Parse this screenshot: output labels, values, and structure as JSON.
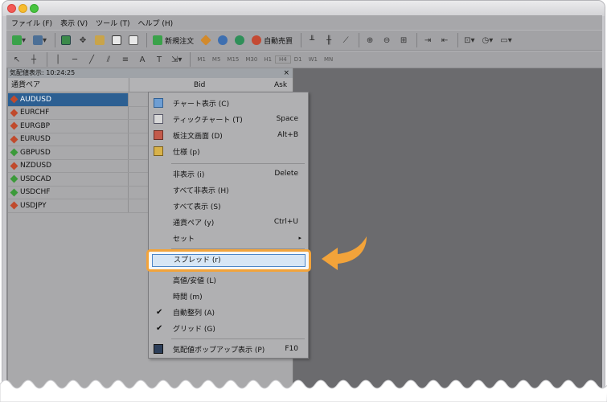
{
  "menubar": {
    "items": [
      "ファイル (F)",
      "表示 (V)",
      "ツール (T)",
      "ヘルプ (H)"
    ]
  },
  "toolbar": {
    "new_order": "新規注文",
    "auto_trade": "自動売買"
  },
  "timeframes": [
    "M1",
    "M5",
    "M15",
    "M30",
    "H1",
    "H4",
    "D1",
    "W1",
    "MN"
  ],
  "market_watch": {
    "title": "気配値表示: 10:24:25",
    "close": "×",
    "col_pair": "通貨ペア",
    "col_bid": "Bid",
    "col_ask": "Ask",
    "rows": [
      "AUDUSD",
      "EURCHF",
      "EURGBP",
      "EURUSD",
      "GBPUSD",
      "NZDUSD",
      "USDCAD",
      "USDCHF",
      "USDJPY"
    ]
  },
  "context_menu": {
    "items": [
      {
        "label": "チャート表示 (C)",
        "shortcut": ""
      },
      {
        "label": "ティックチャート (T)",
        "shortcut": "Space"
      },
      {
        "label": "板注文画面 (D)",
        "shortcut": "Alt+B"
      },
      {
        "label": "仕様 (p)",
        "shortcut": ""
      },
      {
        "label": "非表示 (i)",
        "shortcut": "Delete"
      },
      {
        "label": "すべて非表示 (H)",
        "shortcut": ""
      },
      {
        "label": "すべて表示 (S)",
        "shortcut": ""
      },
      {
        "label": "通貨ペア (y)",
        "shortcut": "Ctrl+U"
      },
      {
        "label": "セット",
        "shortcut": "▸"
      },
      {
        "label": "スプレッド (r)",
        "shortcut": ""
      },
      {
        "label": "高値/安値 (L)",
        "shortcut": ""
      },
      {
        "label": "時間 (m)",
        "shortcut": ""
      },
      {
        "label": "自動整列 (A)",
        "shortcut": ""
      },
      {
        "label": "グリッド (G)",
        "shortcut": ""
      },
      {
        "label": "気配値ポップアップ表示 (P)",
        "shortcut": "F10"
      }
    ],
    "check_mark": "✔"
  },
  "colors": {
    "highlight": "#f2a33a",
    "selection": "#2c5f92"
  }
}
